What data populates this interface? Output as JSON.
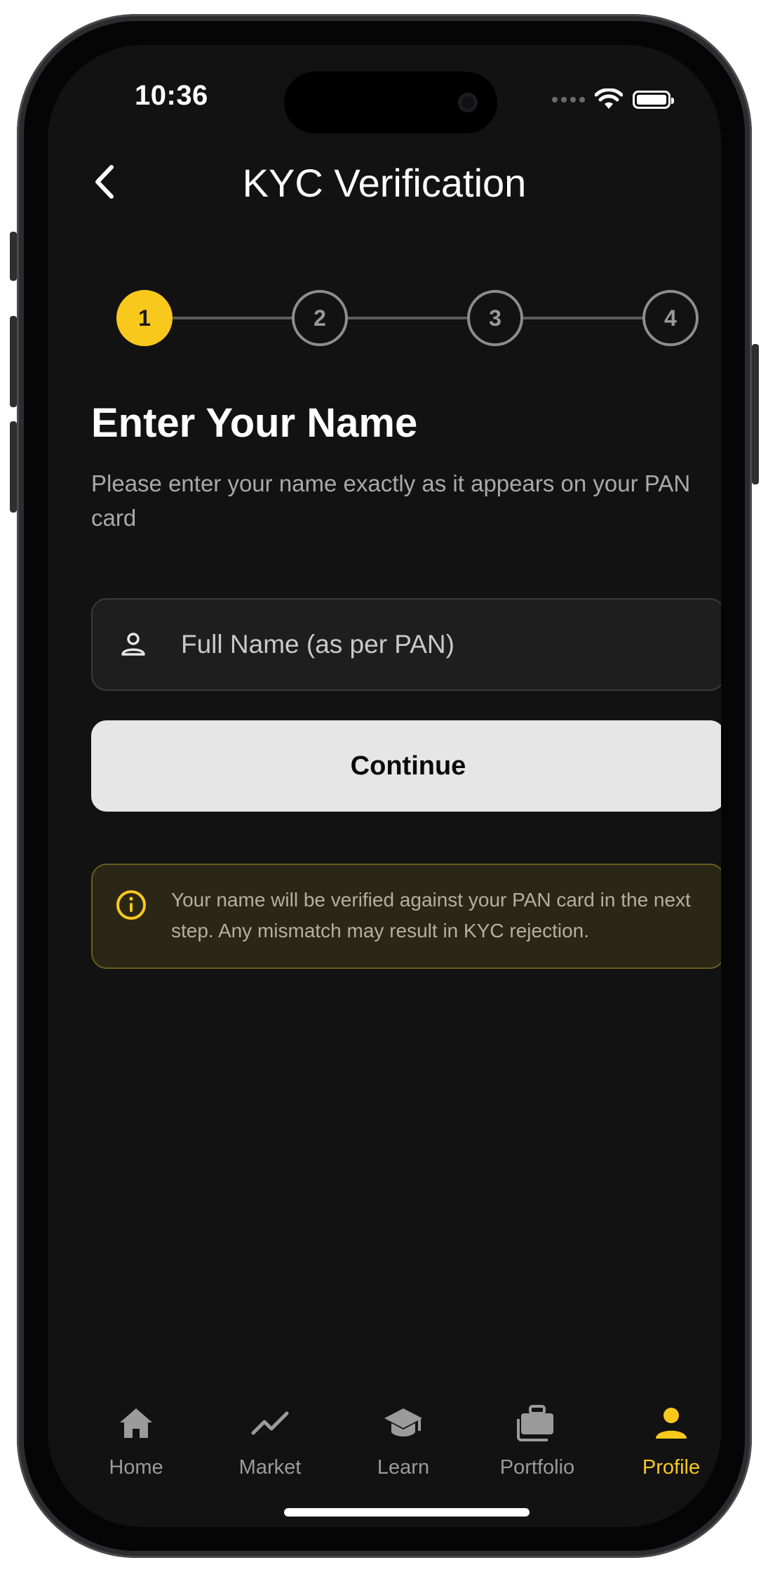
{
  "status_bar": {
    "time": "10:36"
  },
  "header": {
    "title": "KYC Verification"
  },
  "stepper": {
    "steps": [
      "1",
      "2",
      "3",
      "4"
    ],
    "active_step": 1
  },
  "form": {
    "title": "Enter Your Name",
    "subtitle": "Please enter your name exactly as it appears on your PAN card",
    "name_placeholder": "Full Name (as per PAN)",
    "name_value": "",
    "continue_label": "Continue"
  },
  "notice": {
    "text": "Your name will be verified against your PAN card in the next step. Any mismatch may result in KYC rejection."
  },
  "tab_bar": {
    "items": [
      {
        "label": "Home",
        "icon": "home-icon"
      },
      {
        "label": "Market",
        "icon": "trending-up-icon"
      },
      {
        "label": "Learn",
        "icon": "graduation-cap-icon"
      },
      {
        "label": "Portfolio",
        "icon": "briefcase-icon"
      },
      {
        "label": "Profile",
        "icon": "person-icon"
      }
    ],
    "active": "Profile"
  },
  "colors": {
    "accent": "#f8c81c",
    "background": "#121212",
    "notice_bg": "#2b2716",
    "notice_border": "#6a5d1e"
  }
}
